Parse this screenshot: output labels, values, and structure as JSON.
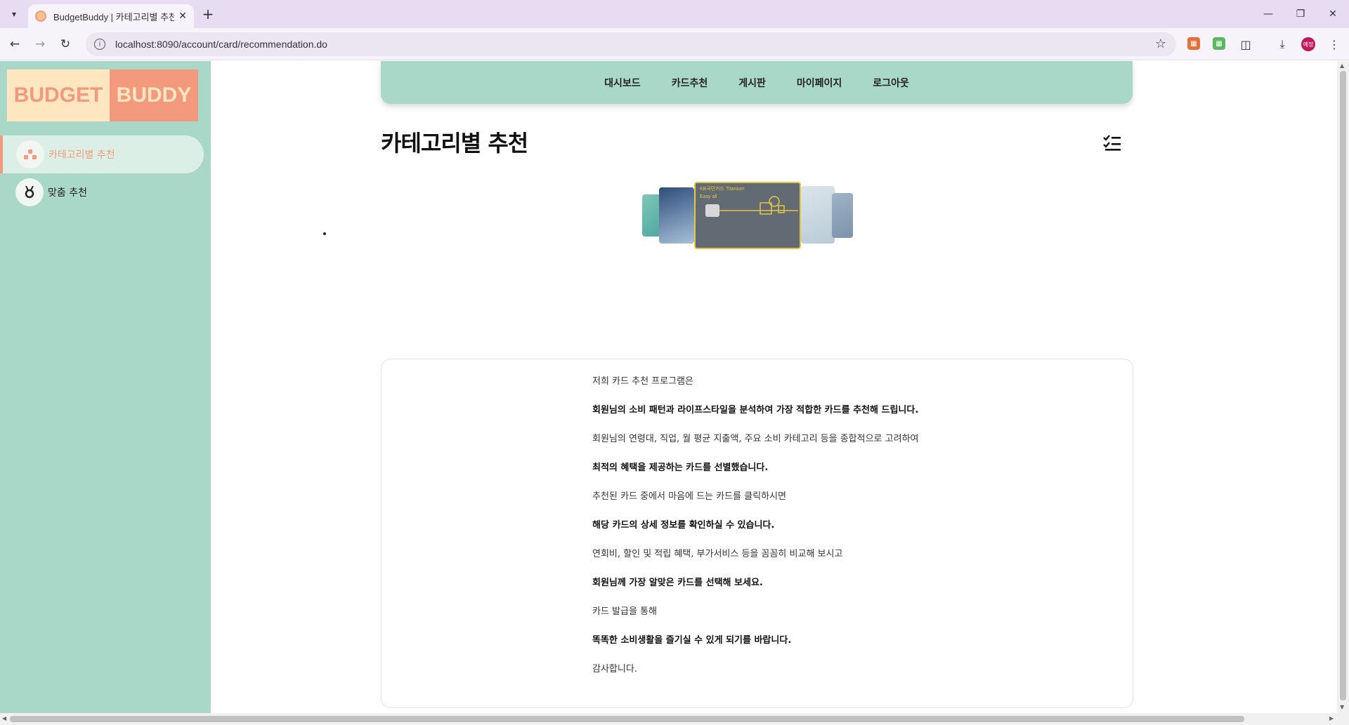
{
  "browser": {
    "tab_title": "BudgetBuddy | 카테고리별 추천",
    "url": "localhost:8090/account/card/recommendation.do",
    "profile_label": "예정"
  },
  "logo": {
    "left": "BUDGET",
    "right": "BUDDY"
  },
  "sidebar": {
    "items": [
      {
        "label": "카테고리별 추천",
        "icon": "category-icon",
        "active": true
      },
      {
        "label": "맞춤 추천",
        "icon": "medal-icon",
        "active": false
      }
    ]
  },
  "topnav": {
    "items": [
      "대시보드",
      "카드추천",
      "게시판",
      "마이페이지",
      "로그아웃"
    ]
  },
  "page": {
    "title": "카테고리별 추천"
  },
  "carousel": {
    "featured_card": {
      "name": "KB국민카드 Titanium",
      "sub": "Easy all"
    }
  },
  "info": {
    "lines": [
      {
        "text": "저희 카드 추천 프로그램은",
        "bold": false
      },
      {
        "text": "회원님의 소비 패턴과 라이프스타일을 분석하여 가장 적합한 카드를 추천해 드립니다.",
        "bold": true
      },
      {
        "text": "회원님의 연령대, 직업, 월 평균 지출액, 주요 소비 카테고리 등을 종합적으로 고려하여",
        "bold": false
      },
      {
        "text": "최적의 혜택을 제공하는 카드를 선별했습니다.",
        "bold": true
      },
      {
        "text": "추천된 카드 중에서 마음에 드는 카드를 클릭하시면",
        "bold": false
      },
      {
        "text": "해당 카드의 상세 정보를 확인하실 수 있습니다.",
        "bold": true
      },
      {
        "text": "연회비, 할인 및 적립 혜택, 부가서비스 등을 꼼꼼히 비교해 보시고",
        "bold": false
      },
      {
        "text": "회원님께 가장 알맞은 카드를 선택해 보세요.",
        "bold": true
      },
      {
        "text": "카드 발급을 통해",
        "bold": false
      },
      {
        "text": "똑똑한 소비생활을 즐기실 수 있게 되기를 바랍니다.",
        "bold": true
      },
      {
        "text": "감사합니다.",
        "bold": false
      }
    ]
  },
  "colors": {
    "mint": "#a9d8c8",
    "coral": "#f39a7e",
    "cream": "#fde6c0"
  }
}
